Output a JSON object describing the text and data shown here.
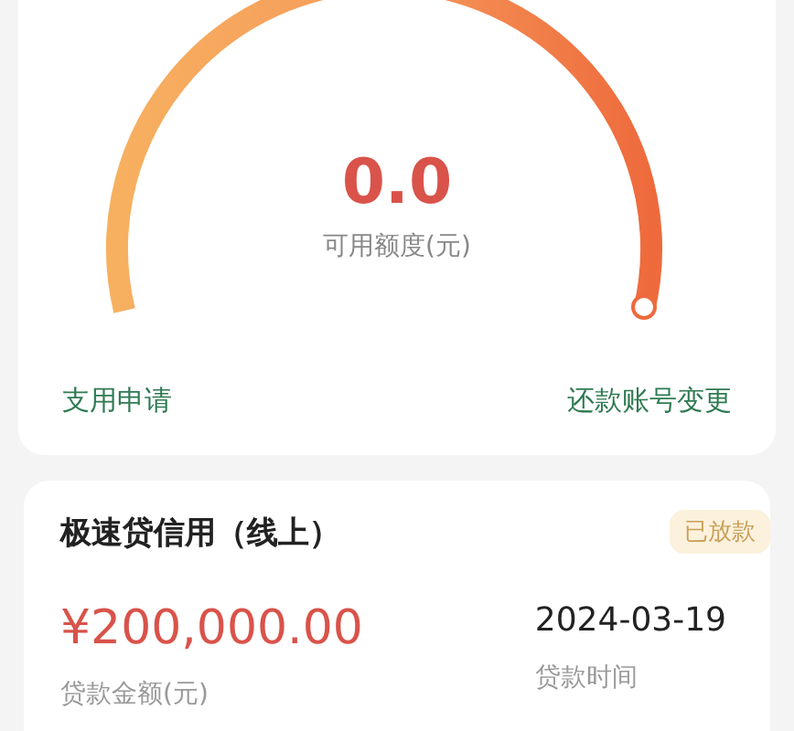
{
  "credit": {
    "amount": "0.0",
    "label": "可用额度(元)"
  },
  "actions": [
    {
      "label": "支用申请"
    },
    {
      "label": "还款账号变更"
    }
  ],
  "loan": {
    "title": "极速贷信用（线上）",
    "status": "已放款",
    "amount": "¥200,000.00",
    "amount_label": "贷款金额(元)",
    "date": "2024-03-19",
    "date_label": "贷款时间"
  }
}
